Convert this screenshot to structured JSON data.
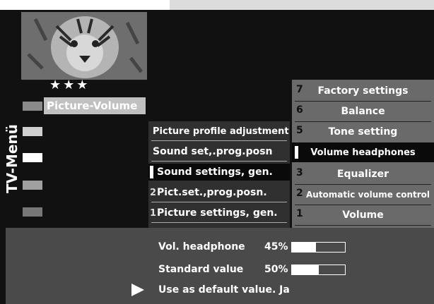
{
  "stars": "★★★",
  "menu_title": "TV-Menü",
  "picture_volume": "Picture-Volume",
  "middle_menu": [
    {
      "num": "",
      "label": "Picture profile adjustment"
    },
    {
      "num": "",
      "label": "Sound set,.prog.posn"
    },
    {
      "num": "",
      "label": "Sound settings, gen.",
      "selected": true
    },
    {
      "num": "2",
      "label": "Pict.set.,prog.posn."
    },
    {
      "num": "1",
      "label": "Picture settings, gen."
    }
  ],
  "right_menu": [
    {
      "num": "7",
      "label": "Factory settings"
    },
    {
      "num": "6",
      "label": "Balance"
    },
    {
      "num": "5",
      "label": "Tone setting"
    },
    {
      "num": "",
      "label": "Volume headphones",
      "selected": true
    },
    {
      "num": "3",
      "label": "Equalizer"
    },
    {
      "num": "2",
      "label": "Automatic volume control"
    },
    {
      "num": "1",
      "label": "Volume"
    }
  ],
  "bottom": {
    "vol_headphone": {
      "label": "Vol. headphone",
      "value": "45%",
      "fraction": 0.45
    },
    "standard": {
      "label": "Standard value",
      "value": "50%",
      "fraction": 0.5
    },
    "default": "Use as default value. Ja"
  },
  "colors": {
    "background": "#111111",
    "panel": "#6a6a6a",
    "bottom_panel": "#4a4a4a"
  }
}
